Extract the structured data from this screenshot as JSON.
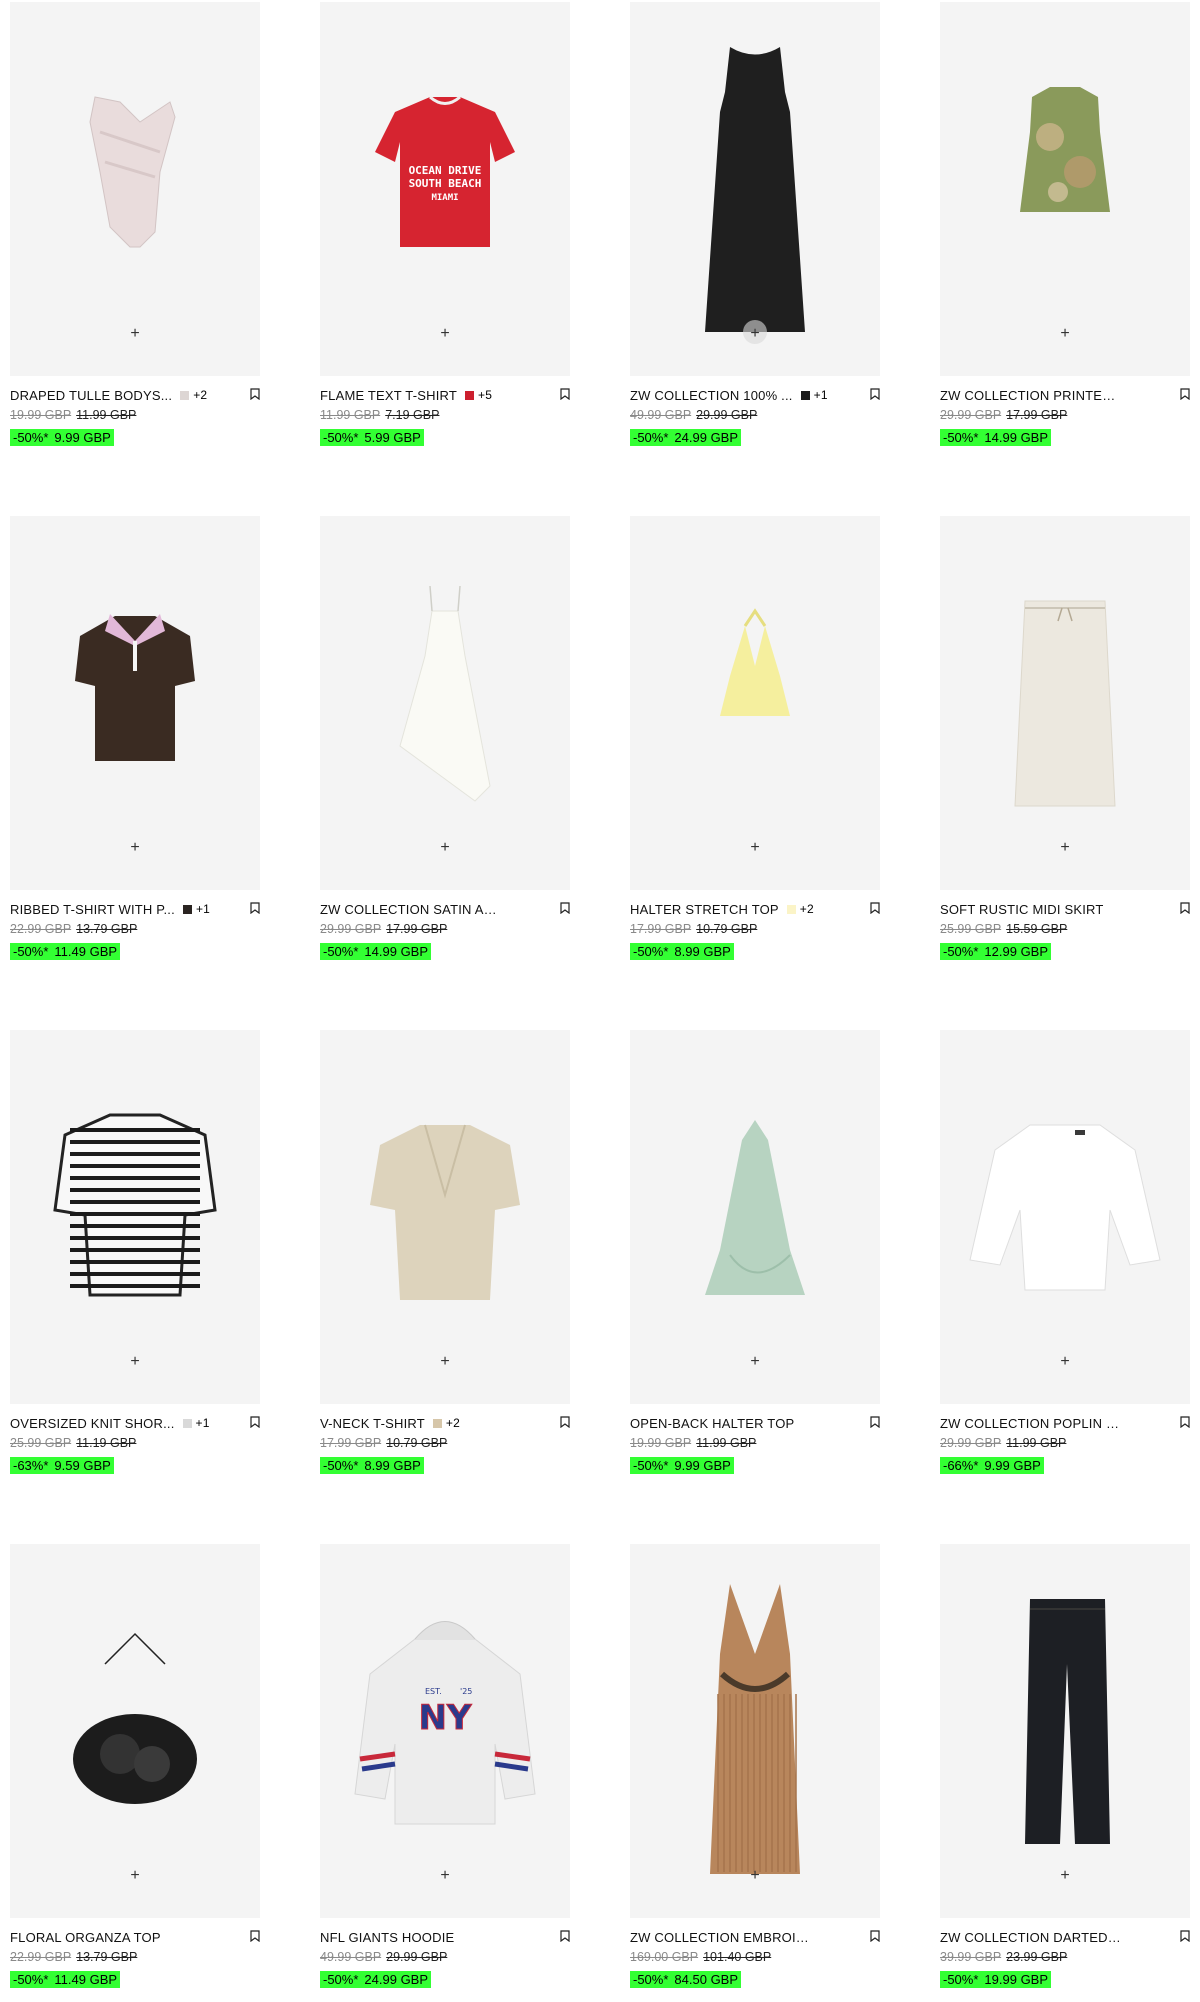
{
  "colors": {
    "card_bg": "#f4f4f4",
    "sale_highlight": "#33ff33"
  },
  "icons": {
    "add": "plus-icon",
    "save": "bookmark-icon"
  },
  "products": [
    {
      "name": "DRAPED TULLE BODYS...",
      "swatch": "#ddd6d4",
      "extra": "+2",
      "original_price": "19.99 GBP",
      "previous_price": "11.99 GBP",
      "discount": "-50%*",
      "sale_price": "9.99 GBP",
      "add_label": "+",
      "image": "bodysuit"
    },
    {
      "name": "FLAME TEXT T-SHIRT",
      "swatch": "#cc1f2e",
      "extra": "+5",
      "original_price": "11.99 GBP",
      "previous_price": "7.19 GBP",
      "discount": "-50%*",
      "sale_price": "5.99 GBP",
      "add_label": "+",
      "image": "red-tshirt",
      "image_text": [
        "OCEAN DRIVE",
        "SOUTH BEACH",
        "MIAMI"
      ]
    },
    {
      "name": "ZW COLLECTION 100% ...",
      "swatch": "#1a1a1a",
      "extra": "+1",
      "original_price": "49.99 GBP",
      "previous_price": "29.99 GBP",
      "discount": "-50%*",
      "sale_price": "24.99 GBP",
      "add_label": "+",
      "image": "black-dress"
    },
    {
      "name": "ZW COLLECTION PRINTED TOP",
      "swatch": null,
      "extra": "",
      "original_price": "29.99 GBP",
      "previous_price": "17.99 GBP",
      "discount": "-50%*",
      "sale_price": "14.99 GBP",
      "add_label": "+",
      "image": "printed-top"
    },
    {
      "name": "RIBBED T-SHIRT WITH P...",
      "swatch": "#2a2421",
      "extra": "+1",
      "original_price": "22.99 GBP",
      "previous_price": "13.79 GBP",
      "discount": "-50%*",
      "sale_price": "11.49 GBP",
      "add_label": "+",
      "image": "polo"
    },
    {
      "name": "ZW COLLECTION SATIN ASY...",
      "swatch": null,
      "extra": "",
      "original_price": "29.99 GBP",
      "previous_price": "17.99 GBP",
      "discount": "-50%*",
      "sale_price": "14.99 GBP",
      "add_label": "+",
      "image": "satin-top"
    },
    {
      "name": "HALTER STRETCH TOP",
      "swatch": "#fbf4c7",
      "extra": "+2",
      "original_price": "17.99 GBP",
      "previous_price": "10.79 GBP",
      "discount": "-50%*",
      "sale_price": "8.99 GBP",
      "add_label": "+",
      "image": "halter"
    },
    {
      "name": "SOFT RUSTIC MIDI SKIRT",
      "swatch": null,
      "extra": "",
      "original_price": "25.99 GBP",
      "previous_price": "15.59 GBP",
      "discount": "-50%*",
      "sale_price": "12.99 GBP",
      "add_label": "+",
      "image": "skirt"
    },
    {
      "name": "OVERSIZED KNIT SHOR...",
      "swatch": "#d9d9d9",
      "extra": "+1",
      "original_price": "25.99 GBP",
      "previous_price": "11.19 GBP",
      "discount": "-63%*",
      "sale_price": "9.59 GBP",
      "add_label": "+",
      "image": "striped"
    },
    {
      "name": "V-NECK T-SHIRT",
      "swatch": "#d6c6a9",
      "extra": "+2",
      "original_price": "17.99 GBP",
      "previous_price": "10.79 GBP",
      "discount": "-50%*",
      "sale_price": "8.99 GBP",
      "add_label": "+",
      "image": "vneck"
    },
    {
      "name": "OPEN-BACK HALTER TOP",
      "swatch": null,
      "extra": "",
      "original_price": "19.99 GBP",
      "previous_price": "11.99 GBP",
      "discount": "-50%*",
      "sale_price": "9.99 GBP",
      "add_label": "+",
      "image": "green-halter"
    },
    {
      "name": "ZW COLLECTION POPLIN SHI...",
      "swatch": null,
      "extra": "",
      "original_price": "29.99 GBP",
      "previous_price": "11.99 GBP",
      "discount": "-66%*",
      "sale_price": "9.99 GBP",
      "add_label": "+",
      "image": "poplin"
    },
    {
      "name": "FLORAL ORGANZA TOP",
      "swatch": null,
      "extra": "",
      "original_price": "22.99 GBP",
      "previous_price": "13.79 GBP",
      "discount": "-50%*",
      "sale_price": "11.49 GBP",
      "add_label": "+",
      "image": "organza"
    },
    {
      "name": "NFL GIANTS HOODIE",
      "swatch": null,
      "extra": "",
      "original_price": "49.99 GBP",
      "previous_price": "29.99 GBP",
      "discount": "-50%*",
      "sale_price": "24.99 GBP",
      "add_label": "+",
      "image": "hoodie",
      "image_text": [
        "EST.",
        "'25",
        "NY"
      ]
    },
    {
      "name": "ZW COLLECTION EMBROIDE...",
      "swatch": null,
      "extra": "",
      "original_price": "169.00 GBP",
      "previous_price": "101.40 GBP",
      "discount": "-50%*",
      "sale_price": "84.50 GBP",
      "add_label": "+",
      "image": "embroidered"
    },
    {
      "name": "ZW COLLECTION DARTED TR...",
      "swatch": null,
      "extra": "",
      "original_price": "39.99 GBP",
      "previous_price": "23.99 GBP",
      "discount": "-50%*",
      "sale_price": "19.99 GBP",
      "add_label": "+",
      "image": "trousers"
    }
  ]
}
